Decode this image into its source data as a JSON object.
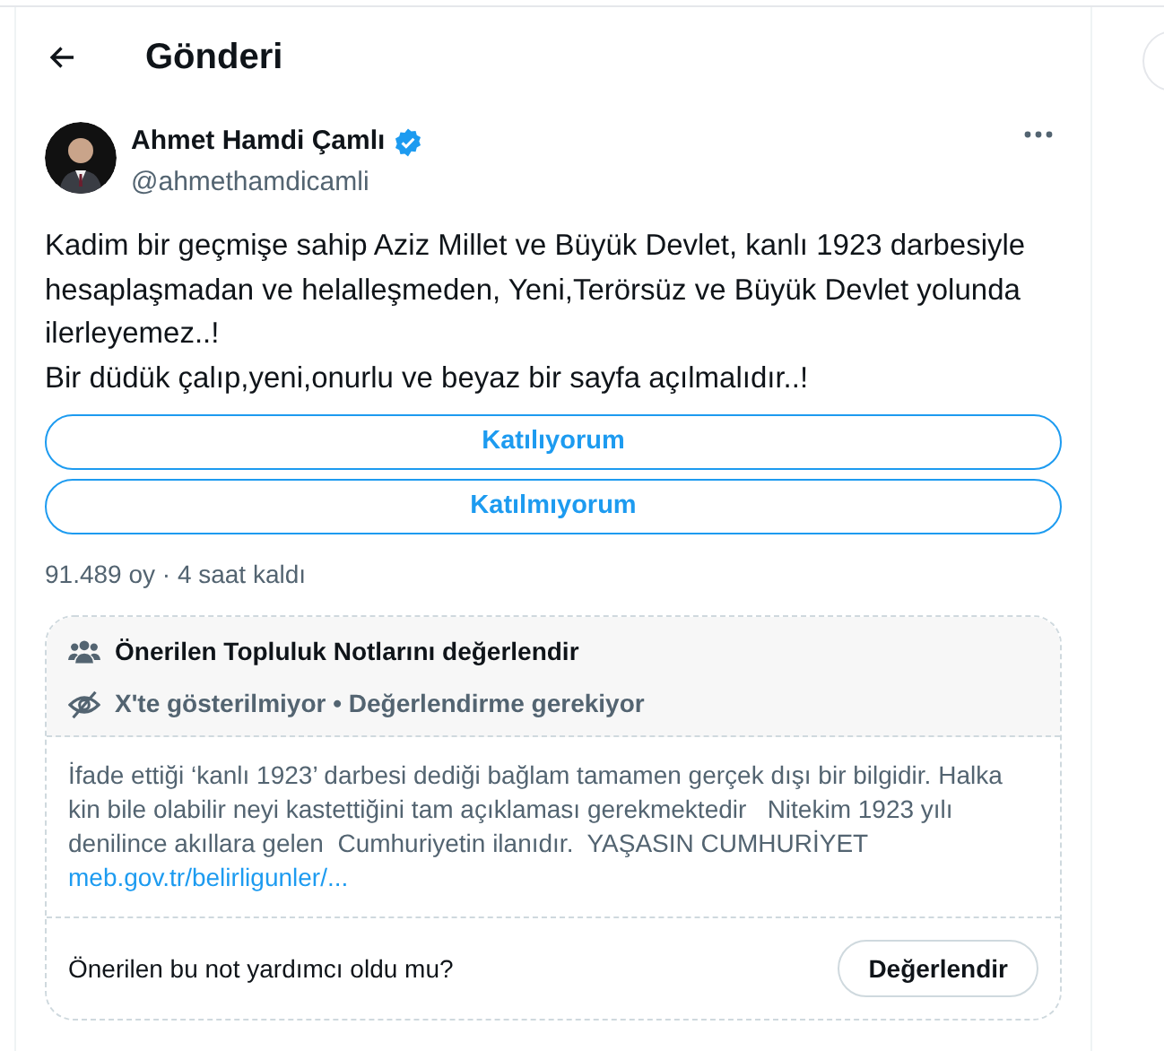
{
  "header": {
    "title": "Gönderi"
  },
  "post": {
    "author_name": "Ahmet Hamdi Çamlı",
    "verified": true,
    "handle": "@ahmethamdicamli",
    "text": [
      "Kadim bir geçmişe sahip Aziz Millet  ve Büyük Devlet, kanlı 1923 darbesiyle hesaplaşmadan ve helalleşmeden, Yeni,Terörsüz ve Büyük Devlet yolunda ilerleyemez..!",
      "Bir düdük çalıp,yeni,onurlu ve beyaz bir sayfa açılmalıdır..!"
    ],
    "poll_options": [
      "Katılıyorum",
      "Katılmıyorum"
    ],
    "poll_meta": "91.489 oy · 4 saat kaldı"
  },
  "community_note": {
    "title": "Önerilen Topluluk Notlarını değerlendir",
    "status": "X'te gösterilmiyor • Değerlendirme gerekiyor",
    "body": "İfade ettiği ‘kanlı 1923’ darbesi dediği bağlam tamamen gerçek dışı bir bilgidir. Halka kin bile olabilir neyi kastettiğini tam açıklaması gerekmektedir   Nitekim 1923 yılı denilince akıllara gelen  Cumhuriyetin ilanıdır.  YAŞASIN CUMHURİYET",
    "link": "meb.gov.tr/belirligunler/...",
    "question": "Önerilen bu not yardımcı oldu mu?",
    "rate_button": "Değerlendir"
  }
}
